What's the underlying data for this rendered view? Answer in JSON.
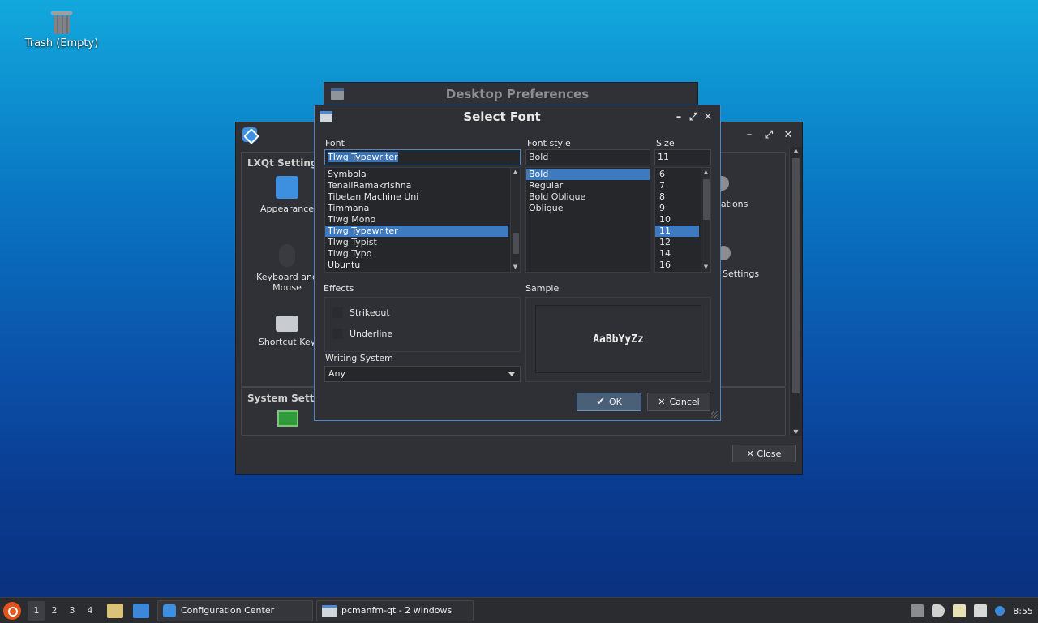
{
  "desktop": {
    "trash_label": "Trash (Empty)"
  },
  "config_center": {
    "group_lxqt": "LXQt Settings",
    "group_system": "System Setti",
    "items": {
      "appearance": "Appearance",
      "keyboard_l1": "Keyboard and",
      "keyboard_l2": "Mouse",
      "shortcut": "Shortcut Key",
      "associations": "ociations",
      "settings": "Settings"
    },
    "close_label": "Close"
  },
  "desktop_prefs": {
    "title": "Desktop Preferences"
  },
  "font_dialog": {
    "title": "Select Font",
    "font_label": "Font",
    "font_style_label": "Font style",
    "size_label": "Size",
    "font_value": "Tlwg Typewriter",
    "style_value": "Bold",
    "size_value": "11",
    "fonts": [
      "Symbola",
      "TenaliRamakrishna",
      "Tibetan Machine Uni",
      "Timmana",
      "Tlwg Mono",
      "Tlwg Typewriter",
      "Tlwg Typist",
      "Tlwg Typo",
      "Ubuntu"
    ],
    "styles": [
      "Bold",
      "Regular",
      "Bold Oblique",
      "Oblique"
    ],
    "sizes": [
      "6",
      "7",
      "8",
      "9",
      "10",
      "11",
      "12",
      "14",
      "16"
    ],
    "effects_label": "Effects",
    "strikeout_label": "Strikeout",
    "underline_label": "Underline",
    "writing_system_label": "Writing System",
    "writing_system_value": "Any",
    "sample_label": "Sample",
    "sample_text": "AaBbYyZz",
    "ok_label": "OK",
    "cancel_label": "Cancel"
  },
  "taskbar": {
    "workspaces": [
      "1",
      "2",
      "3",
      "4"
    ],
    "task_config": "Configuration Center",
    "task_pcmanfm": "pcmanfm-qt - 2 windows",
    "clock": "8:55"
  }
}
